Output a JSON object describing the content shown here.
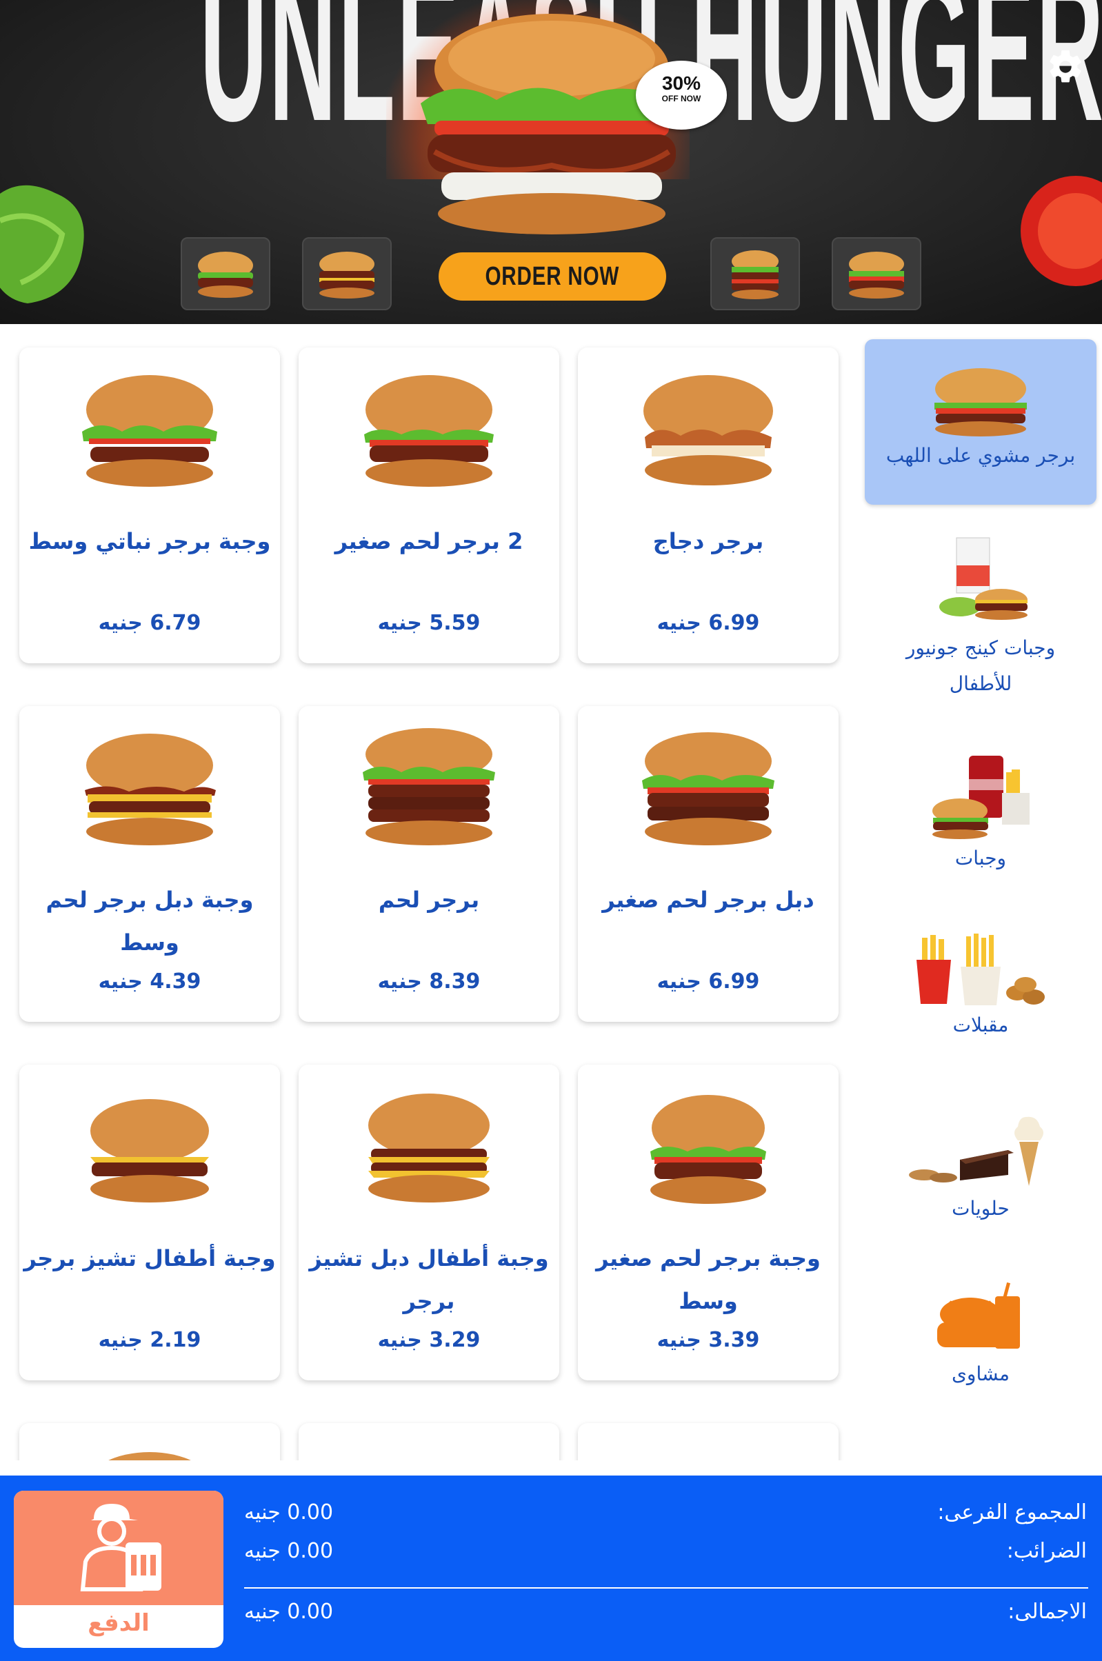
{
  "banner": {
    "headline": "UNLEASH HUNGER",
    "offer_percent": "30%",
    "offer_text": "OFF NOW",
    "order_button": "ORDER NOW"
  },
  "icons": {
    "settings": "gear-icon",
    "pay": "delivery-person-icon"
  },
  "colors": {
    "primary_blue": "#0a5ef6",
    "text_blue": "#1a4fb5",
    "active_category": "#a9c6f7",
    "pay_accent": "#f98a69",
    "order_button": "#f7a21b"
  },
  "categories": [
    {
      "label": "برجر مشوي على اللهب",
      "active": true
    },
    {
      "label": "وجبات كينج جونيور للأطفال",
      "active": false
    },
    {
      "label": "وجبات",
      "active": false
    },
    {
      "label": "مقبلات",
      "active": false
    },
    {
      "label": "حلويات",
      "active": false
    },
    {
      "label": "مشاوى",
      "active": false
    }
  ],
  "products": [
    {
      "name": "برجر دجاج",
      "price": "6.99 جنيه"
    },
    {
      "name": "2 برجر لحم صغير",
      "price": "5.59 جنيه"
    },
    {
      "name": "وجبة برجر نباتي وسط",
      "price": "6.79 جنيه"
    },
    {
      "name": "دبل برجر لحم صغير",
      "price": "6.99 جنيه"
    },
    {
      "name": "برجر لحم",
      "price": "8.39 جنيه"
    },
    {
      "name": "وجبة دبل برجر لحم وسط",
      "price": "4.39 جنيه"
    },
    {
      "name": "وجبة برجر لحم صغير وسط",
      "price": "3.39 جنيه"
    },
    {
      "name": "وجبة أطفال دبل تشيز برجر",
      "price": "3.29 جنيه"
    },
    {
      "name": "وجبة أطفال تشيز برجر",
      "price": "2.19 جنيه"
    }
  ],
  "totals": {
    "subtotal_label": "المجموع الفرعى:",
    "subtotal_value": "0.00 جنيه",
    "tax_label": "الضرائب:",
    "tax_value": "0.00 جنيه",
    "total_label": "الاجمالى:",
    "total_value": "0.00 جنيه",
    "pay_label": "الدفع"
  }
}
